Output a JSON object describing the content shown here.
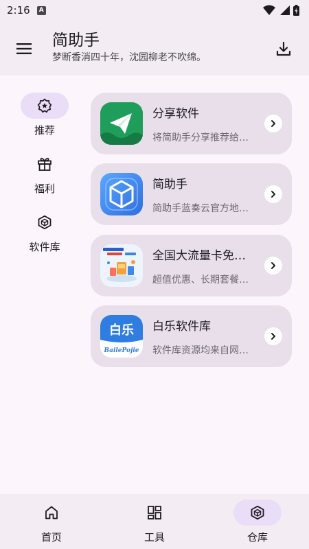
{
  "status_bar": {
    "time": "2:16",
    "notification_glyph": "A"
  },
  "app_bar": {
    "title": "简助手",
    "subtitle": "梦断香消四十年，沈园柳老不吹绵。"
  },
  "rail": {
    "items": [
      {
        "label": "推荐",
        "icon": "star-badge-icon",
        "active": true
      },
      {
        "label": "福利",
        "icon": "gift-icon",
        "active": false
      },
      {
        "label": "软件库",
        "icon": "cube-icon",
        "active": false
      }
    ]
  },
  "cards": [
    {
      "title": "分享软件",
      "desc": "将简助手分享推荐给你的好友",
      "icon": "paper-plane-icon"
    },
    {
      "title": "简助手",
      "desc": "简助手蓝奏云官方地址下载",
      "icon": "cube-app-icon"
    },
    {
      "title": "全国大流量卡免费领取",
      "desc": "超值优惠、长期套餐、全国通用",
      "icon": "sim-card-promo-icon"
    },
    {
      "title": "白乐软件库",
      "desc": "软件库资源均来自网络收集",
      "icon": "baile-logo-icon",
      "logo_text": "白乐",
      "logo_sub": "BailePojie"
    }
  ],
  "bottom_nav": {
    "items": [
      {
        "label": "首页",
        "icon": "home-icon",
        "active": false
      },
      {
        "label": "工具",
        "icon": "grid-icon",
        "active": false
      },
      {
        "label": "仓库",
        "icon": "cube-icon",
        "active": true
      }
    ]
  },
  "colors": {
    "background": "#fcf6fc",
    "bar": "#f3edf3",
    "card": "#e8dfea",
    "active_pill": "#e9ddf7"
  }
}
